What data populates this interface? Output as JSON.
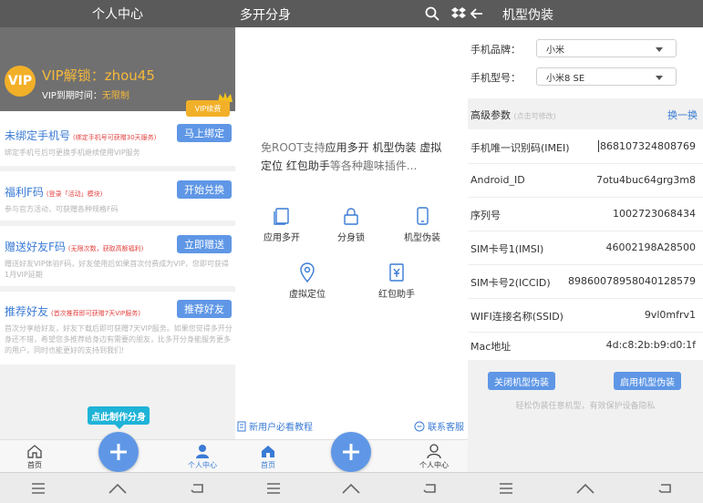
{
  "p1": {
    "header_title": "个人中心",
    "vip_badge": "VIP",
    "vip_unlock": "VIP解锁：zhou45",
    "vip_expire_label": "VIP到期时间：",
    "vip_expire_value": "无限制",
    "vip_button": "VIP续费",
    "cards": [
      {
        "title": "未绑定手机号",
        "note": "(绑定手机号可获赠30天服务)",
        "button": "马上绑定",
        "desc": "绑定手机号后可更换手机继续使用VIP服务"
      },
      {
        "title": "福利F码",
        "note": "(登录「活动」模块)",
        "button": "开始兑换",
        "desc": "参与官方活动，可获赠各种规格F码"
      },
      {
        "title": "赠送好友F码",
        "note": "(无限次数，获取高额福利)",
        "button": "立即赠送",
        "desc": "赠送好友VIP体验F码，好友使用后如果首次付费成为VIP，您即可获得1月VIP延期"
      },
      {
        "title": "推荐好友",
        "note": "(首次推荐即可获赠7天VIP服务)",
        "button": "推荐好友",
        "desc": "首次分享给好友，好友下载后即可获赠7天VIP服务。如果您觉得多开分身还不错，希望您多推荐给身边有需要的朋友，比多开分身能服务更多的用户，同时也能更好的支持到我们!"
      }
    ],
    "bubble": "点此制作分身",
    "tab_home": "首页",
    "tab_profile": "个人中心"
  },
  "p2": {
    "header_title": "多开分身",
    "intro_1": "免ROOT支持",
    "intro_b1": "应用多开 机型伪装 虚拟定位 红包助手",
    "intro_2": "等各种趣味插件...",
    "features": [
      "应用多开",
      "分身锁",
      "机型伪装",
      "虚拟定位",
      "红包助手"
    ],
    "link_tutorial": "新用户必看教程",
    "link_service": "联系客服",
    "tab_home": "首页",
    "tab_profile": "个人中心"
  },
  "p3": {
    "header_title": "机型伪装",
    "brand_label": "手机品牌：",
    "brand_value": "小米",
    "model_label": "手机型号：",
    "model_value": "小米8 SE",
    "adv_label": "高级参数",
    "adv_note": "(点击可修改)",
    "adv_link": "换一换",
    "params": [
      {
        "k": "手机唯一识别码(IMEI)",
        "v": "868107324808769"
      },
      {
        "k": "Android_ID",
        "v": "7otu4buc64grg3m8"
      },
      {
        "k": "序列号",
        "v": "1002723068434"
      },
      {
        "k": "SIM卡号1(IMSI)",
        "v": "46002198A28500"
      },
      {
        "k": "SIM卡号2(ICCID)",
        "v": "89860078958040128579"
      },
      {
        "k": "WIFI连接名称(SSID)",
        "v": "9vl0mfrv1"
      },
      {
        "k": "Mac地址",
        "v": "4d:c8:2b:b9:d0:1f"
      }
    ],
    "btn_close": "关闭机型伪装",
    "btn_open": "启用机型伪装",
    "hint": "轻松伪装任意机型，有效保护设备隐私"
  },
  "colors": {
    "accent": "#5f97e6",
    "vip": "#f2b028",
    "note_red": "#e2423f"
  }
}
